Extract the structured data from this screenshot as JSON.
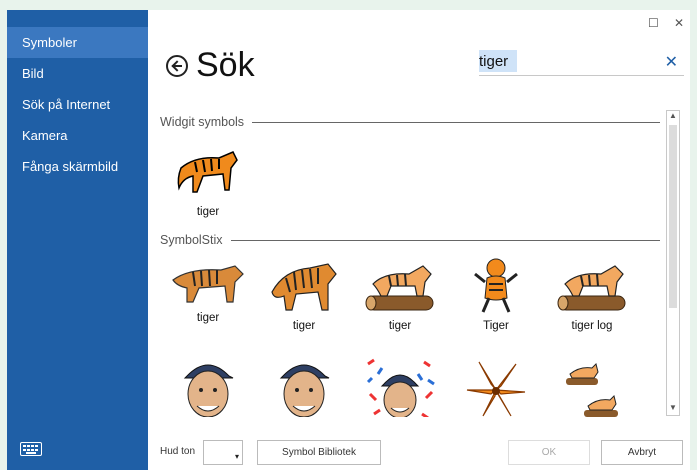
{
  "sidebar": {
    "items": [
      {
        "label": "Symboler"
      },
      {
        "label": "Bild"
      },
      {
        "label": "Sök på Internet"
      },
      {
        "label": "Kamera"
      },
      {
        "label": "Fånga skärmbild"
      }
    ],
    "keyboard_icon": "keyboard-icon"
  },
  "window": {
    "maximize_glyph": "☐",
    "close_glyph": "✕"
  },
  "header": {
    "title": "Sök",
    "back_icon": "back-arrow-icon"
  },
  "search": {
    "value": "tiger",
    "clear_glyph": "✕"
  },
  "sections": [
    {
      "title": "Widgit symbols",
      "items": [
        {
          "label": "tiger",
          "icon": "tiger-icon"
        }
      ]
    },
    {
      "title": "SymbolStix",
      "items": [
        {
          "label": "tiger",
          "icon": "tiger-icon"
        },
        {
          "label": "tiger",
          "icon": "tiger-icon"
        },
        {
          "label": "tiger",
          "icon": "tiger-on-log-icon"
        },
        {
          "label": "Tiger",
          "icon": "cartoon-tiger-icon"
        },
        {
          "label": "tiger log",
          "icon": "tiger-on-log-icon"
        },
        {
          "label": "",
          "icon": "golfer-face-icon"
        },
        {
          "label": "",
          "icon": "golfer-face-icon"
        },
        {
          "label": "",
          "icon": "golfer-confetti-icon"
        },
        {
          "label": "",
          "icon": "tiger-lily-icon"
        },
        {
          "label": "",
          "icon": "tigers-on-logs-icon"
        }
      ]
    }
  ],
  "footer": {
    "hud_label": "Hud ton",
    "library_button": "Symbol Bibliotek",
    "ok_button": "OK",
    "cancel_button": "Avbryt"
  }
}
